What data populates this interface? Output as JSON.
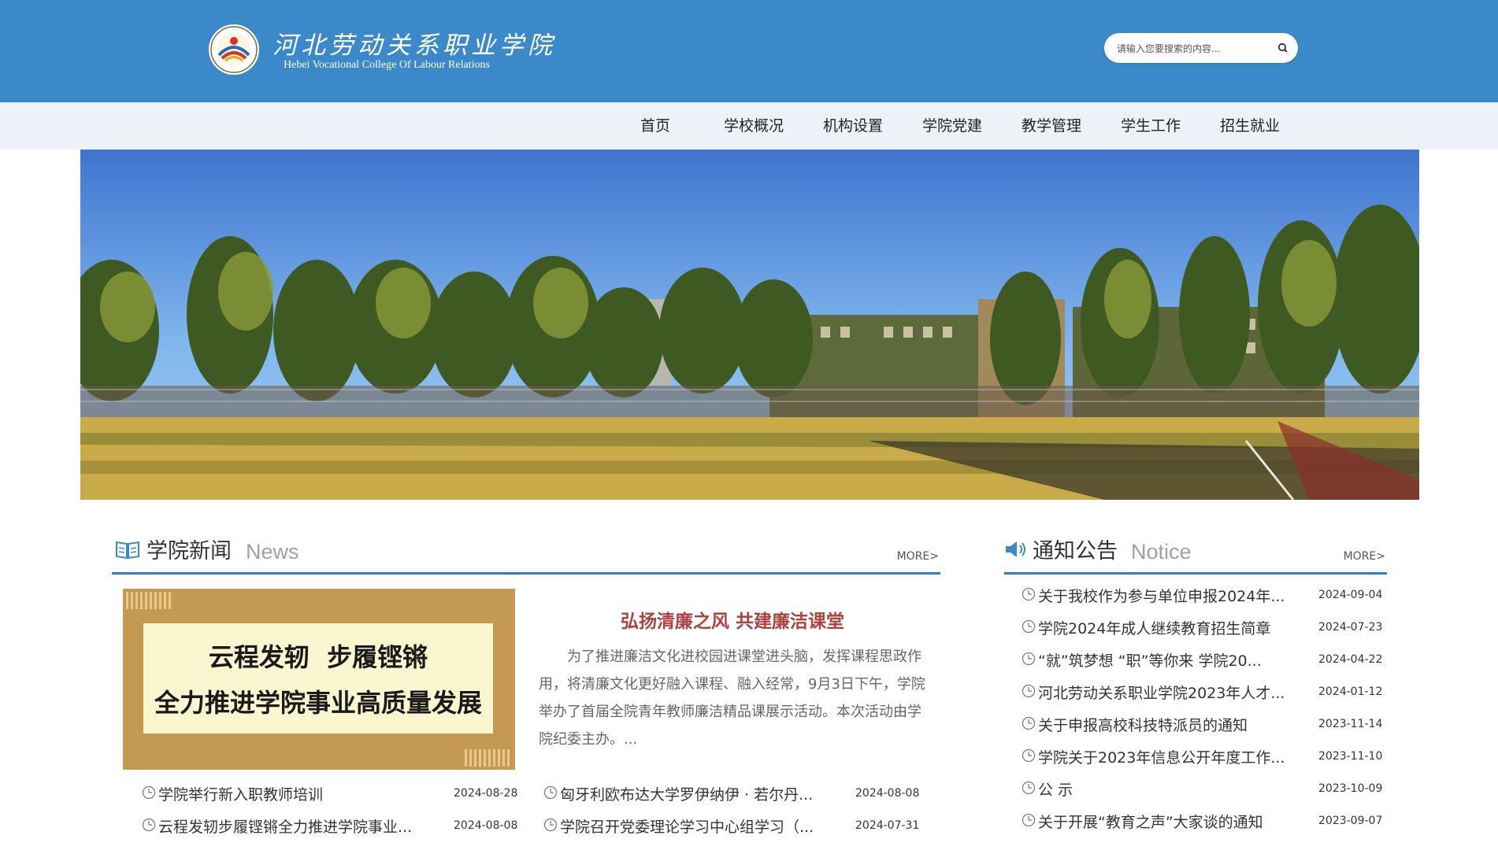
{
  "header": {
    "logo_cn": "河北劳动关系职业学院",
    "logo_en": "Hebei Vocational College Of Labour Relations",
    "search_placeholder": "请输入您要搜索的内容...",
    "search_icon": "search-icon"
  },
  "nav": {
    "items": [
      {
        "label": "首页"
      },
      {
        "label": "学校概况"
      },
      {
        "label": "机构设置"
      },
      {
        "label": "学院党建"
      },
      {
        "label": "教学管理"
      },
      {
        "label": "学生工作"
      },
      {
        "label": "招生就业"
      }
    ]
  },
  "colors": {
    "header_bg": "#3b89c9",
    "nav_bg": "#edf2f8",
    "accent": "#2f7cc0",
    "feature_title": "#b0413e"
  },
  "news": {
    "title": "学院新闻",
    "title_en": "News",
    "more": "MORE>",
    "feature_image": {
      "line1": "云程发轫  步履铿锵",
      "line2": "全力推进学院事业高质量发展"
    },
    "feature_title": "弘扬清廉之风 共建廉洁课堂",
    "feature_summary": "为了推进廉洁文化进校园进课堂进头脑，发挥课程思政作用，将清廉文化更好融入课程、融入经常，9月3日下午，学院举办了首届全院青年教师廉洁精品课展示活动。本次活动由学院纪委主办。...",
    "left_list": [
      {
        "title": "学院举行新入职教师培训",
        "date": "2024-08-28"
      },
      {
        "title": "云程发轫步履铿锵全力推进学院事业...",
        "date": "2024-08-08"
      }
    ],
    "right_list": [
      {
        "title": "匈牙利欧布达大学罗伊纳伊 · 若尔丹...",
        "date": "2024-08-08"
      },
      {
        "title": "学院召开党委理论学习中心组学习（...",
        "date": "2024-07-31"
      }
    ]
  },
  "notice": {
    "title": "通知公告",
    "title_en": "Notice",
    "more": "MORE>",
    "items": [
      {
        "title": "关于我校作为参与单位申报2024年...",
        "date": "2024-09-04"
      },
      {
        "title": "学院2024年成人继续教育招生简章",
        "date": "2024-07-23"
      },
      {
        "title": "“就”筑梦想 “职”等你来 学院20...",
        "date": "2024-04-22"
      },
      {
        "title": "河北劳动关系职业学院2023年人才...",
        "date": "2024-01-12"
      },
      {
        "title": "关于申报高校科技特派员的通知",
        "date": "2023-11-14"
      },
      {
        "title": "学院关于2023年信息公开年度工作...",
        "date": "2023-11-10"
      },
      {
        "title": "公 示",
        "date": "2023-10-09"
      },
      {
        "title": "关于开展“教育之声”大家谈的通知",
        "date": "2023-09-07"
      }
    ]
  }
}
